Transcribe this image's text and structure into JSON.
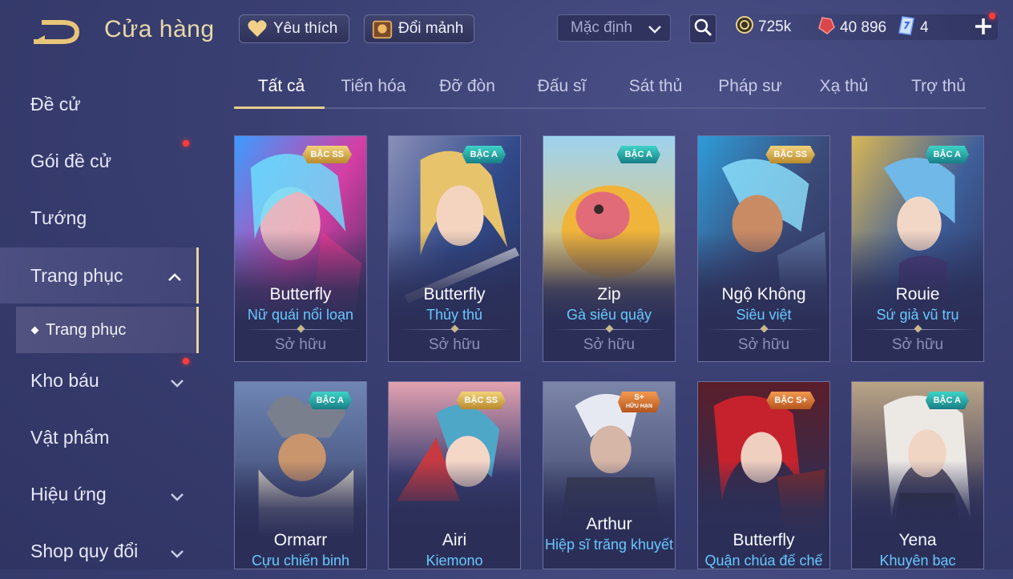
{
  "header": {
    "title": "Cửa hàng",
    "favorites_label": "Yêu thích",
    "exchange_label": "Đổi mảnh",
    "sort_value": "Mặc định",
    "gold": "725k",
    "ruby": "40 896",
    "voucher": "4"
  },
  "sidebar": {
    "items": [
      {
        "label": "Đề cử"
      },
      {
        "label": "Gói đề cử"
      },
      {
        "label": "Tướng"
      },
      {
        "label": "Trang phục"
      },
      {
        "label": "Trang phục"
      },
      {
        "label": "Kho báu"
      },
      {
        "label": "Vật phẩm"
      },
      {
        "label": "Hiệu ứng"
      },
      {
        "label": "Shop quy đổi"
      }
    ]
  },
  "tabs": [
    {
      "label": "Tất cả"
    },
    {
      "label": "Tiến hóa"
    },
    {
      "label": "Đỡ đòn"
    },
    {
      "label": "Đấu sĩ"
    },
    {
      "label": "Sát thủ"
    },
    {
      "label": "Pháp sư"
    },
    {
      "label": "Xạ thủ"
    },
    {
      "label": "Trợ thủ"
    }
  ],
  "cards": [
    {
      "hero": "Butterfly",
      "skin": "Nữ quái nổi loạn",
      "status": "Sở hữu",
      "rank": "BẬC SS"
    },
    {
      "hero": "Butterfly",
      "skin": "Thủy thủ",
      "status": "Sở hữu",
      "rank": "BẬC A"
    },
    {
      "hero": "Zip",
      "skin": "Gà siêu quậy",
      "status": "Sở hữu",
      "rank": "BẬC A"
    },
    {
      "hero": "Ngộ Không",
      "skin": "Siêu việt",
      "status": "Sở hữu",
      "rank": "BẬC SS"
    },
    {
      "hero": "Rouie",
      "skin": "Sứ giả vũ trụ",
      "status": "Sở hữu",
      "rank": "BẬC A"
    },
    {
      "hero": "Ormarr",
      "skin": "Cựu chiến binh",
      "rank": "BẬC A"
    },
    {
      "hero": "Airi",
      "skin": "Kiemono",
      "rank": "BẬC SS"
    },
    {
      "hero": "Arthur",
      "skin": "Hiệp sĩ trăng khuyết",
      "rank": "S+",
      "rank_sub": "HỮU HẠN"
    },
    {
      "hero": "Butterfly",
      "skin": "Quận chúa đế chế",
      "rank": "BẬC S+"
    },
    {
      "hero": "Yena",
      "skin": "Khuyên bạc",
      "rank": "BẬC A"
    }
  ],
  "colors": {
    "accent_gold": "#e7cf8c",
    "skin_blue": "#68c7ff",
    "background": "#3a3f72"
  }
}
